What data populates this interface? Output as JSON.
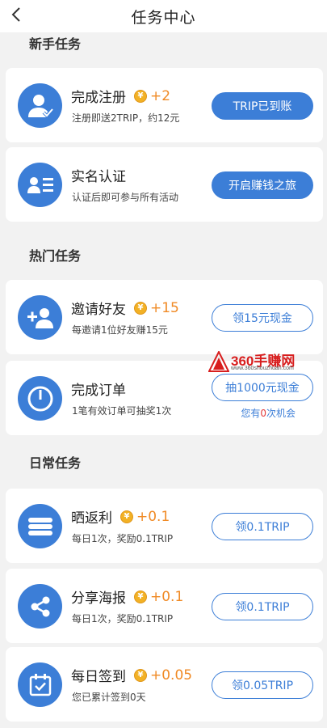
{
  "header": {
    "title": "任务中心"
  },
  "sections": [
    {
      "title": "新手任务"
    },
    {
      "title": "热门任务"
    },
    {
      "title": "日常任务"
    }
  ],
  "colors": {
    "primary": "#3c7ed7",
    "reward": "#f08a25",
    "coin": "#f2b125",
    "highlight": "#e23b3b"
  },
  "tasks": [
    {
      "icon": "user-check-icon",
      "name": "完成注册",
      "reward": "+2",
      "desc": "注册即送2TRIP，约12元",
      "button": "TRIP已到账",
      "button_style": "solid"
    },
    {
      "icon": "id-card-icon",
      "name": "实名认证",
      "desc": "认证后即可参与所有活动",
      "button": "开启赚钱之旅",
      "button_style": "solid"
    },
    {
      "icon": "add-user-icon",
      "name": "邀请好友",
      "reward": "+15",
      "desc": "每邀请1位好友赚15元",
      "button": "领15元现金",
      "button_style": "outline"
    },
    {
      "icon": "power-icon",
      "name": "完成订单",
      "desc": "1笔有效订单可抽奖1次",
      "button": "抽1000元现金",
      "button_style": "outline",
      "chance_prefix": "您有",
      "chance_num": "0",
      "chance_suffix": "次机会"
    },
    {
      "icon": "list-icon",
      "name": "晒返利",
      "reward": "+0.1",
      "desc": "每日1次，奖励0.1TRIP",
      "button": "领0.1TRIP",
      "button_style": "outline"
    },
    {
      "icon": "share-icon",
      "name": "分享海报",
      "reward": "+0.1",
      "desc": "每日1次，奖励0.1TRIP",
      "button": "领0.1TRIP",
      "button_style": "outline"
    },
    {
      "icon": "calendar-check-icon",
      "name": "每日签到",
      "reward": "+0.05",
      "desc": "您已累计签到0天",
      "button": "领0.05TRIP",
      "button_style": "outline"
    }
  ],
  "watermark": {
    "text": "360手赚网",
    "url": "www.360shouzhuan.com"
  }
}
